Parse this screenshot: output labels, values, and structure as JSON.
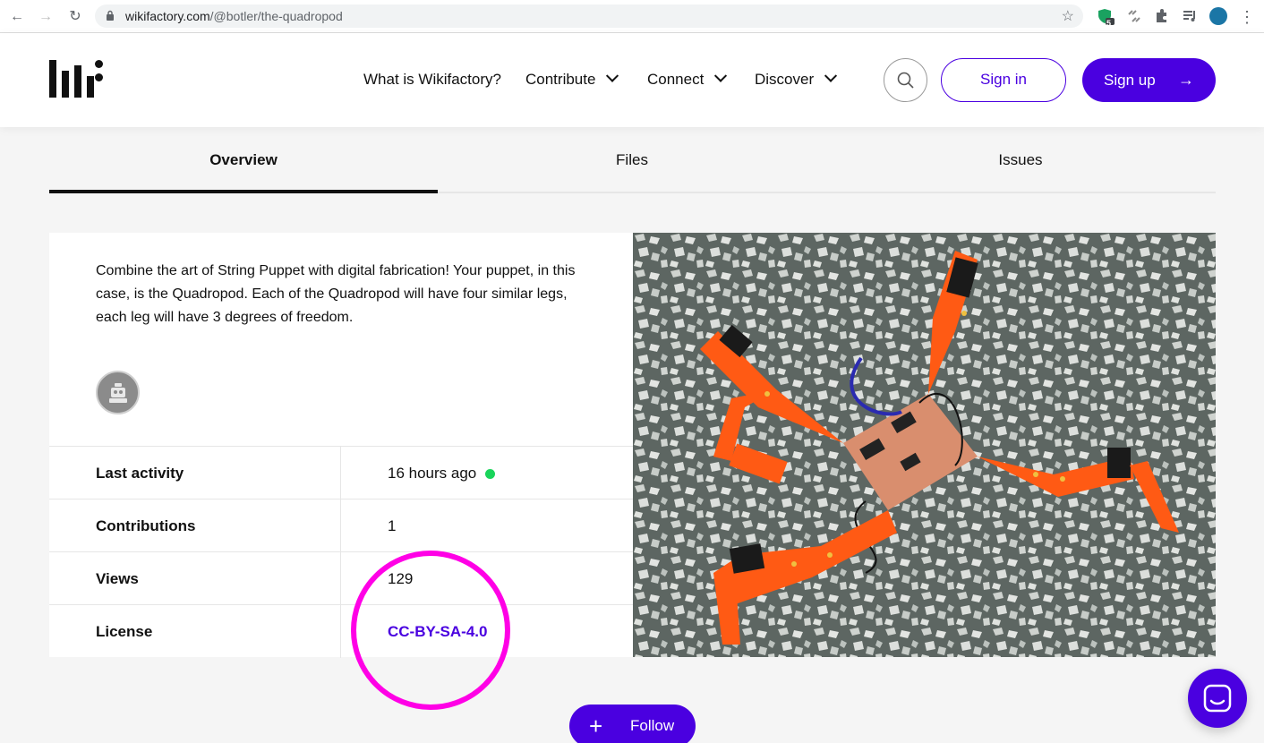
{
  "browser": {
    "url_host": "wikifactory.com",
    "url_path": "/@botler/the-quadropod",
    "extension_badge": "5"
  },
  "header": {
    "nav": [
      {
        "label": "What is Wikifactory?"
      },
      {
        "label": "Contribute"
      },
      {
        "label": "Connect"
      },
      {
        "label": "Discover"
      }
    ],
    "sign_in": "Sign in",
    "sign_up": "Sign up",
    "accent_color": "#4a00e0"
  },
  "tabs": [
    {
      "label": "Overview",
      "active": true
    },
    {
      "label": "Files",
      "active": false
    },
    {
      "label": "Issues",
      "active": false
    }
  ],
  "project": {
    "description": "Combine the art of String Puppet with digital fabrication! Your puppet, in this case, is the Quadropod. Each of the Quadropod will have four similar legs, each leg will have 3 degrees of freedom.",
    "stats": [
      {
        "label": "Last activity",
        "value": "16 hours ago"
      },
      {
        "label": "Contributions",
        "value": "1"
      },
      {
        "label": "Views",
        "value": "129"
      },
      {
        "label": "License",
        "value": "CC-BY-SA-4.0"
      }
    ]
  },
  "actions": {
    "follow": "Follow"
  },
  "colors": {
    "highlight": "#ff00e6",
    "activity_dot": "#19d45a"
  }
}
